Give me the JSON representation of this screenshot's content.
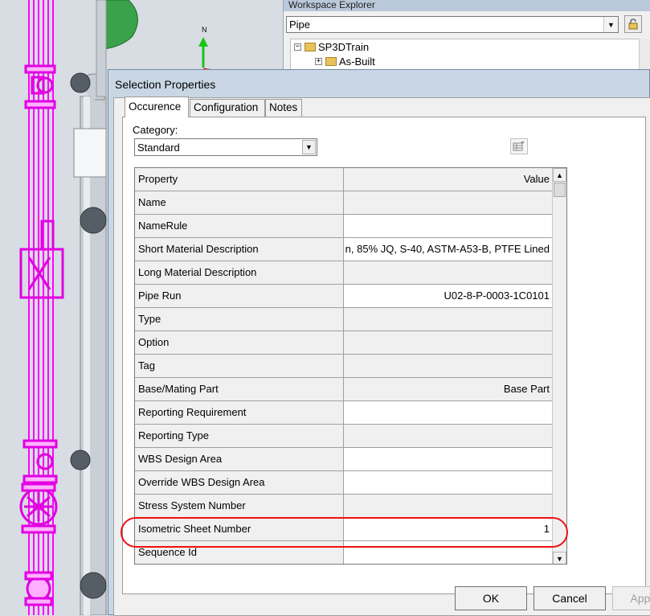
{
  "workspace_explorer": {
    "title": "Workspace Explorer",
    "filter_value": "Pipe",
    "tree": [
      {
        "label": "SP3DTrain",
        "expander": "−"
      },
      {
        "label": "As-Built",
        "expander": "+"
      }
    ]
  },
  "scene": {
    "compass_label": "N",
    "pipe_color": "#ff00ff",
    "pipe_accent": "#e000e0"
  },
  "dialog": {
    "title": "Selection Properties",
    "tabs": [
      "Occurence",
      "Configuration",
      "Notes"
    ],
    "active_tab": "Occurence",
    "category_label": "Category:",
    "category_value": "Standard",
    "grid_header": {
      "property": "Property",
      "value": "Value"
    },
    "rows": [
      {
        "property": "Name",
        "value": ""
      },
      {
        "property": "NameRule",
        "value": ""
      },
      {
        "property": "Short Material Description",
        "value": "n, 85% JQ, S-40, ASTM-A53-B, PTFE Lined"
      },
      {
        "property": "Long Material Description",
        "value": ""
      },
      {
        "property": "Pipe Run",
        "value": "U02-8-P-0003-1C0101"
      },
      {
        "property": "Type",
        "value": ""
      },
      {
        "property": "Option",
        "value": ""
      },
      {
        "property": "Tag",
        "value": ""
      },
      {
        "property": "Base/Mating Part",
        "value": "Base Part"
      },
      {
        "property": "Reporting Requirement",
        "value": ""
      },
      {
        "property": "Reporting Type",
        "value": ""
      },
      {
        "property": "WBS Design Area",
        "value": ""
      },
      {
        "property": "Override WBS Design Area",
        "value": ""
      },
      {
        "property": "Stress System Number",
        "value": ""
      },
      {
        "property": "Isometric Sheet Number",
        "value": "1"
      },
      {
        "property": "Sequence Id",
        "value": ""
      }
    ],
    "highlighted_row": "Isometric Sheet Number",
    "highlight_color": "#ee1111",
    "buttons": {
      "ok": "OK",
      "cancel": "Cancel",
      "apply": "Apply"
    }
  }
}
